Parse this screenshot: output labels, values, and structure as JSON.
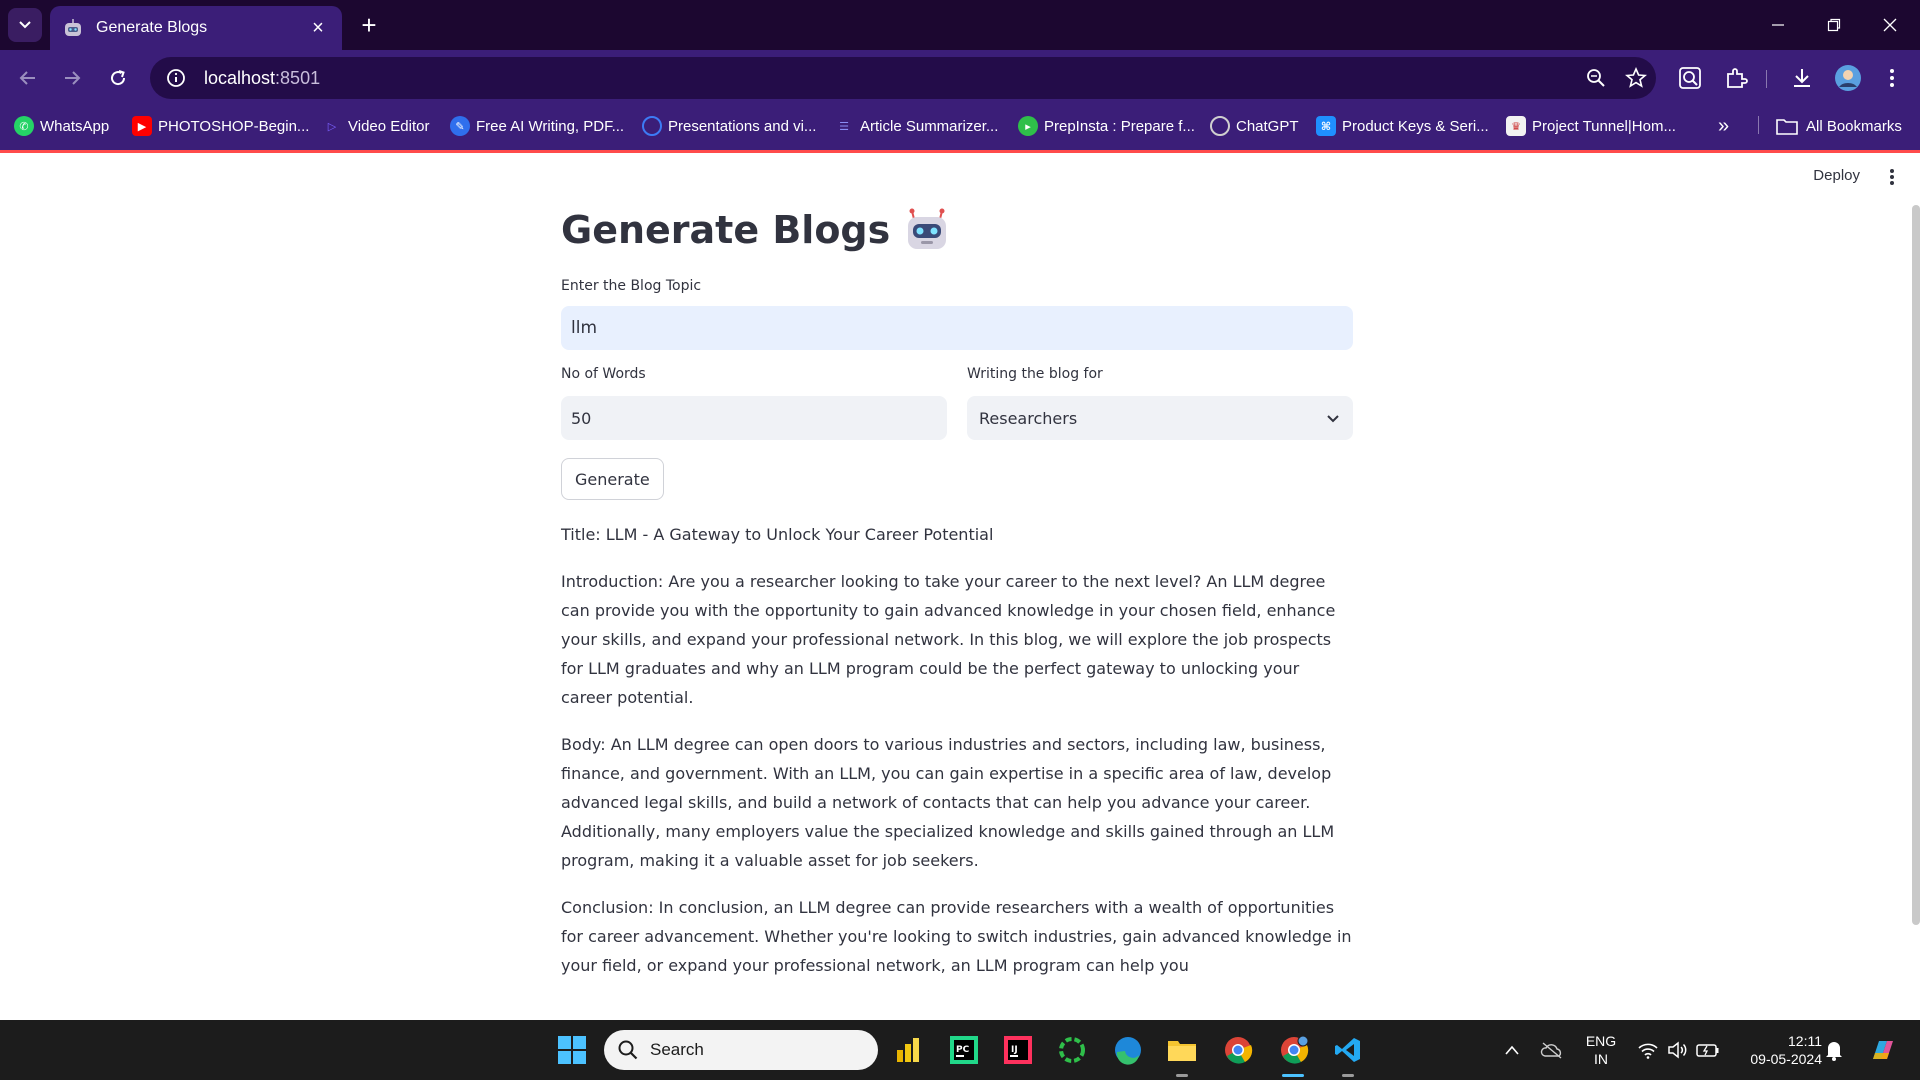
{
  "browser": {
    "tab_title": "Generate Blogs",
    "url_host": "localhost",
    "url_port": ":8501",
    "bookmarks": [
      {
        "label": "WhatsApp",
        "icon": "whatsapp-icon",
        "color": "#25d366"
      },
      {
        "label": "PHOTOSHOP-Begin...",
        "icon": "youtube-icon",
        "color": "#ff0000"
      },
      {
        "label": "Video Editor",
        "icon": "video-editor-icon",
        "color": "#7b61ff"
      },
      {
        "label": "Free AI Writing, PDF...",
        "icon": "ai-writing-icon",
        "color": "#2f6fed"
      },
      {
        "label": "Presentations and vi...",
        "icon": "presentations-icon",
        "color": "#3d7bf5"
      },
      {
        "label": "Article Summarizer...",
        "icon": "summarizer-icon",
        "color": "#5b5fe6"
      },
      {
        "label": "PrepInsta : Prepare f...",
        "icon": "prepinsta-icon",
        "color": "#2fbf4a"
      },
      {
        "label": "ChatGPT",
        "icon": "chatgpt-icon",
        "color": "#9aa0a6"
      },
      {
        "label": "Product Keys & Seri...",
        "icon": "product-keys-icon",
        "color": "#1f8fff"
      },
      {
        "label": "Project Tunnel|Hom...",
        "icon": "project-tunnel-icon",
        "color": "#f2f2f2"
      }
    ],
    "all_bookmarks": "All Bookmarks"
  },
  "app": {
    "deploy_label": "Deploy",
    "title": "Generate Blogs",
    "topic_label": "Enter the Blog Topic",
    "topic_value": "llm",
    "words_label": "No of Words",
    "words_value": "50",
    "audience_label": "Writing the blog for",
    "audience_value": "Researchers",
    "generate_label": "Generate",
    "output": [
      "Title: LLM - A Gateway to Unlock Your Career Potential",
      "Introduction: Are you a researcher looking to take your career to the next level? An LLM degree can provide you with the opportunity to gain advanced knowledge in your chosen field, enhance your skills, and expand your professional network. In this blog, we will explore the job prospects for LLM graduates and why an LLM program could be the perfect gateway to unlocking your career potential.",
      "Body: An LLM degree can open doors to various industries and sectors, including law, business, finance, and government. With an LLM, you can gain expertise in a specific area of law, develop advanced legal skills, and build a network of contacts that can help you advance your career. Additionally, many employers value the specialized knowledge and skills gained through an LLM program, making it a valuable asset for job seekers.",
      "Conclusion: In conclusion, an LLM degree can provide researchers with a wealth of opportunities for career advancement. Whether you're looking to switch industries, gain advanced knowledge in your field, or expand your professional network, an LLM program can help you"
    ]
  },
  "taskbar": {
    "search_label": "Search",
    "lang_line1": "ENG",
    "lang_line2": "IN",
    "time": "12:11",
    "date": "09-05-2024"
  },
  "colors": {
    "chrome_dark": "#1c0730",
    "chrome_purple": "#3b1e78",
    "streamlit_red": "#ff4b4b",
    "text": "#31333f"
  }
}
